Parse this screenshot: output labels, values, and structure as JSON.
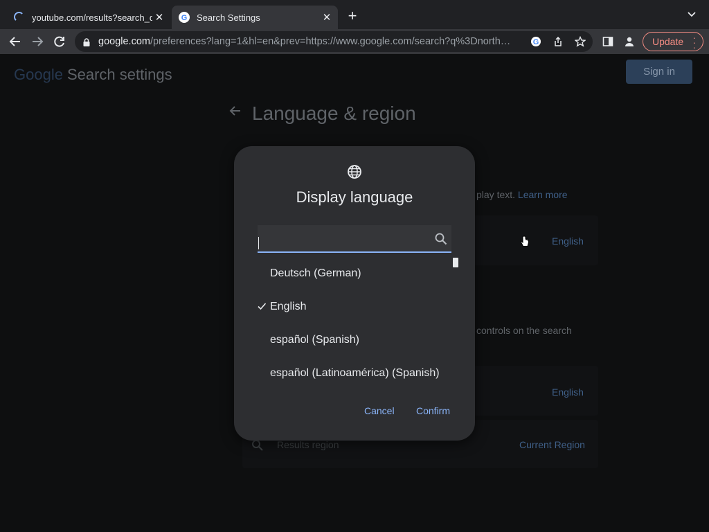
{
  "browser": {
    "tabs": [
      {
        "title": "youtube.com/results?search_q",
        "state": "loading"
      },
      {
        "title": "Search Settings",
        "state": "active"
      }
    ],
    "new_tab_symbol": "+",
    "address": {
      "host": "google.com",
      "path": "/preferences?lang=1&hl=en&prev=https://www.google.com/search?q%3Dnorth…"
    },
    "update_label": "Update",
    "icons": [
      "back-icon",
      "forward-icon",
      "reload-icon",
      "lock-icon",
      "google-lens-icon",
      "share-icon",
      "star-icon",
      "side-panel-icon",
      "profile-icon",
      "menu-icon"
    ]
  },
  "page": {
    "brand": "Google",
    "brand_suffix": "Search settings",
    "sign_in": "Sign in",
    "heading": "Language & region",
    "display_desc": "play text.",
    "learn_more": "Learn more",
    "display_value": "English",
    "search_desc": "controls on the search",
    "search_value": "English",
    "results_region_label": "Results region",
    "results_region_value": "Current Region"
  },
  "dialog": {
    "title": "Display language",
    "search_value": "",
    "search_placeholder": "",
    "items": [
      {
        "label": "Deutsch  (German)",
        "checked": false
      },
      {
        "label": "English",
        "checked": true
      },
      {
        "label": "español  (Spanish)",
        "checked": false
      },
      {
        "label": "español (Latinoamérica)  (Spanish)",
        "checked": false
      }
    ],
    "cancel": "Cancel",
    "confirm": "Confirm"
  },
  "colors": {
    "accent": "#8ab4f8",
    "update": "#f28b82",
    "dialog_bg": "#2d2e31"
  }
}
